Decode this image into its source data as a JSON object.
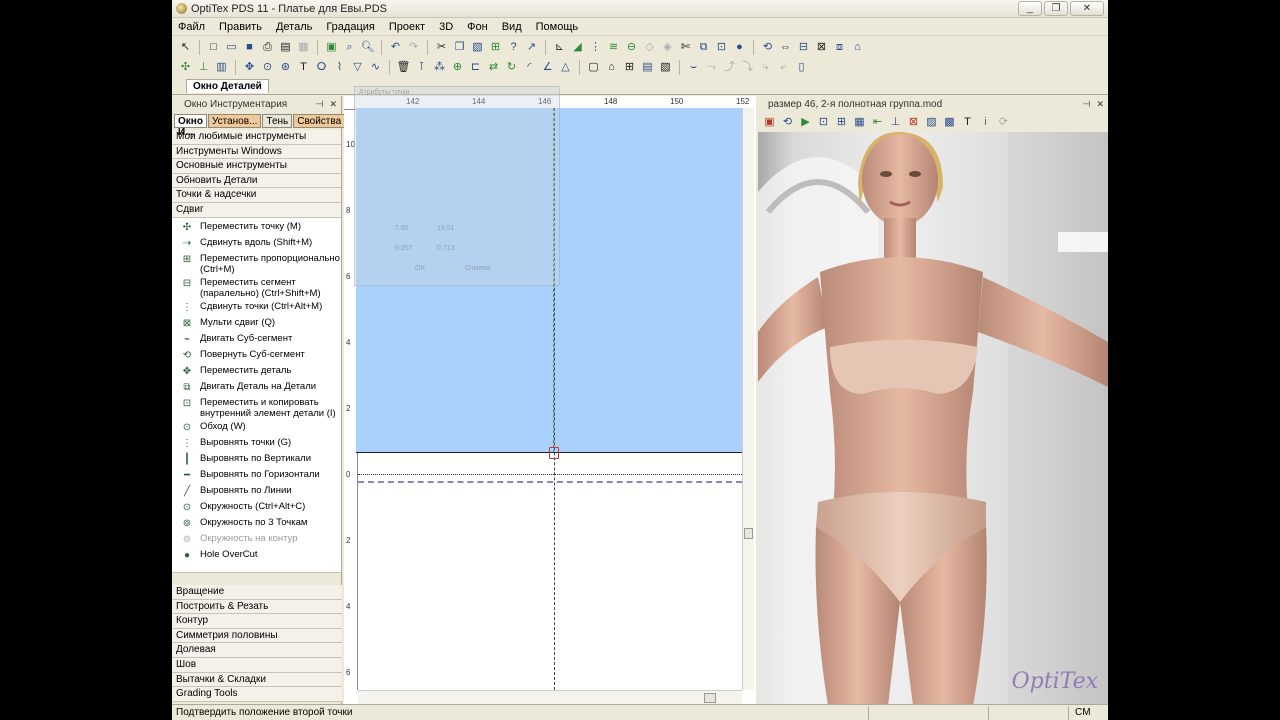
{
  "window": {
    "title": "OptiTex PDS 11 - Платье для Евы.PDS",
    "buttons": [
      "_",
      "❐",
      "✕"
    ]
  },
  "menu": [
    "Файл",
    "Править",
    "Деталь",
    "Градация",
    "Проект",
    "3D",
    "Фон",
    "Вид",
    "Помощь"
  ],
  "doc_tab": "Окно Деталей",
  "left_panel": {
    "title": "Окно Инструментария",
    "tabs": [
      "Окно И...",
      "Установ...",
      "Тень",
      "Свойства"
    ],
    "top_categories": [
      "Мои любимые инструменты",
      "Инструменты Windows",
      "Основные инструменты",
      "Обновить Детали",
      "Точки & надсечки",
      "Сдвиг"
    ],
    "tools": [
      {
        "label": "Переместить точку (M)",
        "icon": "move-point-icon",
        "disabled": false
      },
      {
        "label": "Сдвинуть вдоль (Shift+M)",
        "icon": "slide-along-icon",
        "disabled": false
      },
      {
        "label": "Переместить пропорционально (Ctrl+M)",
        "icon": "move-proportional-icon",
        "disabled": false
      },
      {
        "label": "Переместить сегмент (паралельно) (Ctrl+Shift+M)",
        "icon": "move-segment-icon",
        "disabled": false
      },
      {
        "label": "Сдвинуть точки (Ctrl+Alt+M)",
        "icon": "shift-points-icon",
        "disabled": false
      },
      {
        "label": "Мульти сдвиг (Q)",
        "icon": "multi-shift-icon",
        "disabled": false
      },
      {
        "label": "Двигать Суб-сегмент",
        "icon": "move-subsegment-icon",
        "disabled": false
      },
      {
        "label": "Повернуть Суб-сегмент",
        "icon": "rotate-subsegment-icon",
        "disabled": false
      },
      {
        "label": "Переместить деталь",
        "icon": "move-piece-icon",
        "disabled": false
      },
      {
        "label": "Двигать Деталь на Детали",
        "icon": "piece-on-piece-icon",
        "disabled": false
      },
      {
        "label": "Переместить и копировать внутренний элемент детали (I)",
        "icon": "move-copy-internal-icon",
        "disabled": false
      },
      {
        "label": "Обход (W)",
        "icon": "walk-icon",
        "disabled": false
      },
      {
        "label": "Выровнять точки (G)",
        "icon": "align-points-icon",
        "disabled": false
      },
      {
        "label": "Выровнять по Вертикали",
        "icon": "align-vertical-icon",
        "disabled": false
      },
      {
        "label": "Выровнять по Горизонтали",
        "icon": "align-horizontal-icon",
        "disabled": false
      },
      {
        "label": "Выровнять по Линии",
        "icon": "align-line-icon",
        "disabled": false
      },
      {
        "label": "Окружность (Ctrl+Alt+C)",
        "icon": "circle-icon",
        "disabled": false
      },
      {
        "label": "Окружность по 3 Точкам",
        "icon": "circle-3pt-icon",
        "disabled": false
      },
      {
        "label": "Окружность на контур",
        "icon": "circle-contour-icon",
        "disabled": true
      },
      {
        "label": "Hole OverCut",
        "icon": "hole-overcut-icon",
        "disabled": false
      }
    ],
    "bottom_categories": [
      "Вращение",
      "Построить & Резать",
      "Контур",
      "Симметрия половины",
      "Долевая",
      "Шов",
      "Вытачки & Складки",
      "Grading Tools"
    ]
  },
  "canvas": {
    "ruler_top": [
      "142",
      "144",
      "146",
      "148",
      "150",
      "152"
    ],
    "ruler_left": [
      "10",
      "8",
      "6",
      "4",
      "2",
      "0",
      "2",
      "4",
      "6"
    ],
    "ghost_dialog": {
      "title": "Атрибуты точки",
      "ok": "OK",
      "cancel": "Отмена",
      "field1": "7.85",
      "field2": "19.51",
      "field3": "0.207",
      "field4": "0.713"
    }
  },
  "view3d": {
    "title": "размер 46, 2-я полнотная группа.mod",
    "watermark": "OptiTex"
  },
  "status": {
    "text": "Подтвердить положение второй точки",
    "unit": "CM"
  },
  "colors": {
    "piece_fill": "#a9d1fb",
    "panel_bg": "#ece9d8",
    "tab_orange": "#f1c898"
  }
}
